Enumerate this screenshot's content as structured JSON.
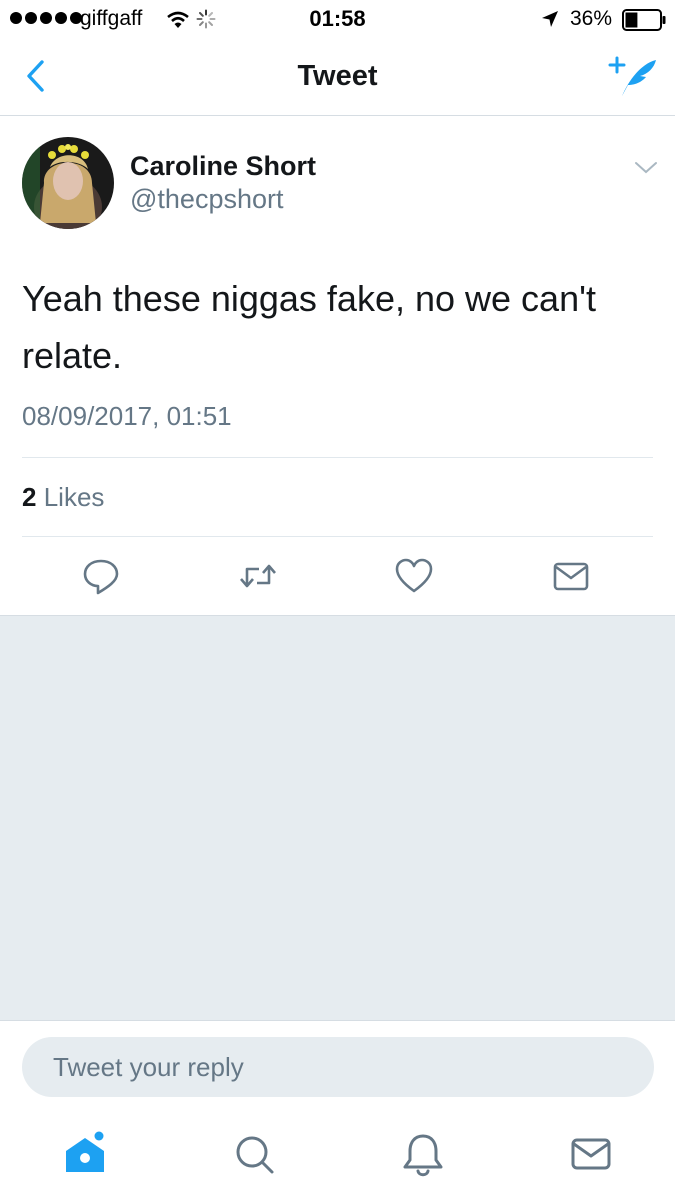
{
  "status_bar": {
    "carrier": "giffgaff",
    "time": "01:58",
    "battery": "36%",
    "battery_level": 0.36,
    "signal_bars": 5
  },
  "nav": {
    "title": "Tweet",
    "back_icon": "chevron-left-icon",
    "compose_icon": "compose-tweet-icon",
    "accent_color": "#1da1f2"
  },
  "tweet": {
    "author_name": "Caroline Short",
    "author_handle": "@thecpshort",
    "text": "Yeah these niggas fake, no we can't relate.",
    "timestamp": "08/09/2017, 01:51",
    "likes_count": "2",
    "likes_label": "Likes",
    "actions": [
      "reply-icon",
      "retweet-icon",
      "like-icon",
      "direct-message-icon"
    ]
  },
  "reply": {
    "placeholder": "Tweet your reply"
  },
  "tab_bar": {
    "tabs": [
      "home-icon",
      "search-icon",
      "notifications-icon",
      "messages-icon"
    ],
    "active_color": "#1da1f2",
    "inactive_color": "#657786"
  }
}
